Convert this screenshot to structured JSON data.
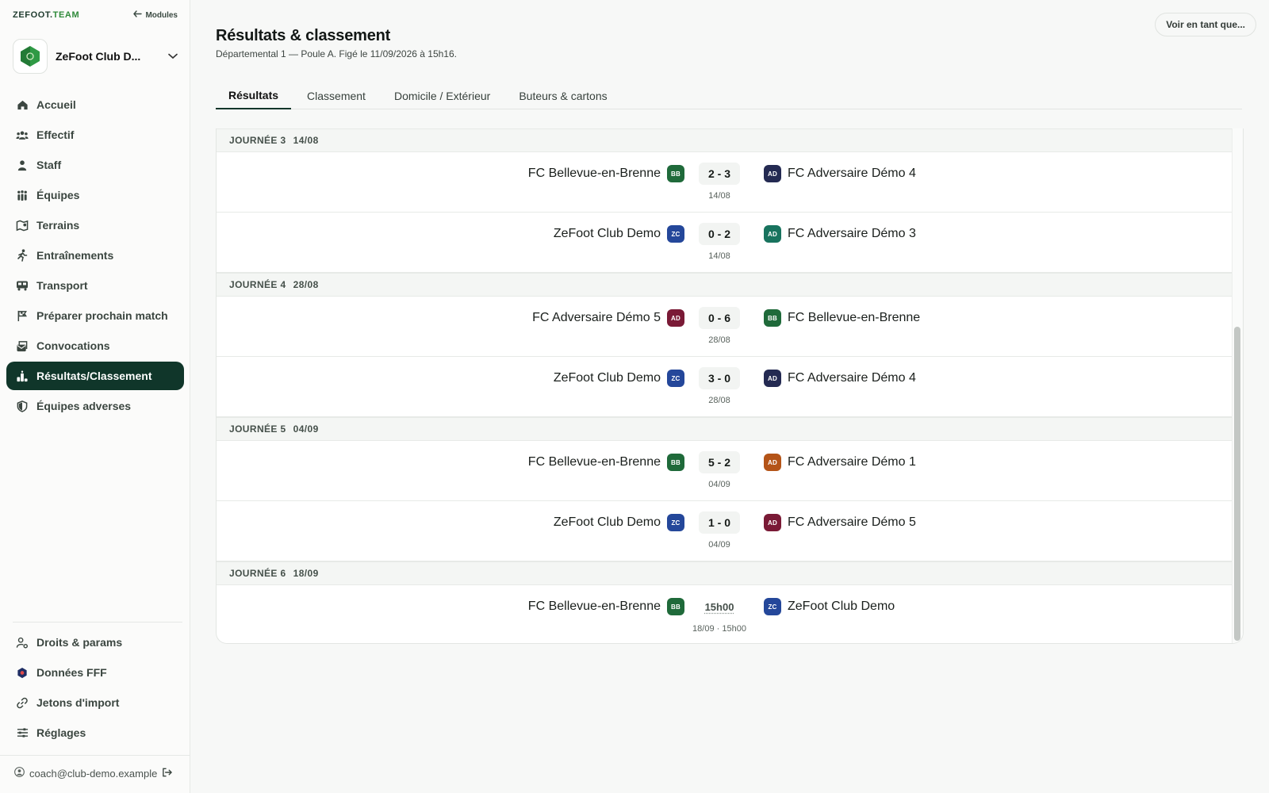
{
  "app": {
    "brand_main": "ZEFOOT.",
    "brand_accent": "TEAM",
    "modules_label": "Modules",
    "club_name": "ZeFoot Club D...",
    "user_email": "coach@club-demo.example"
  },
  "nav": {
    "items": [
      {
        "label": "Accueil",
        "icon": "home-icon"
      },
      {
        "label": "Effectif",
        "icon": "users-icon"
      },
      {
        "label": "Staff",
        "icon": "person-icon"
      },
      {
        "label": "Équipes",
        "icon": "teams-icon"
      },
      {
        "label": "Terrains",
        "icon": "map-icon"
      },
      {
        "label": "Entraînements",
        "icon": "running-icon"
      },
      {
        "label": "Transport",
        "icon": "bus-icon"
      },
      {
        "label": "Préparer prochain match",
        "icon": "flag-icon"
      },
      {
        "label": "Convocations",
        "icon": "envelope-icon"
      },
      {
        "label": "Résultats/Classement",
        "icon": "podium-icon",
        "active": true
      },
      {
        "label": "Équipes adverses",
        "icon": "shield-icon"
      }
    ],
    "bottom": [
      {
        "label": "Droits & params",
        "icon": "user-gear-icon"
      },
      {
        "label": "Données FFF",
        "icon": "fff-icon"
      },
      {
        "label": "Jetons d'import",
        "icon": "link-icon"
      },
      {
        "label": "Réglages",
        "icon": "sliders-icon"
      }
    ]
  },
  "header": {
    "title": "Résultats & classement",
    "subtitle": "Départemental 1 — Poule A. Figé le 11/09/2026 à 15h16.",
    "view_as": "Voir en tant que..."
  },
  "tabs": [
    {
      "label": "Résultats",
      "active": true
    },
    {
      "label": "Classement"
    },
    {
      "label": "Domicile / Extérieur"
    },
    {
      "label": "Buteurs & cartons"
    }
  ],
  "colors": {
    "BB": "#1f6a3a",
    "ZC": "#24479a",
    "AD_navy": "#242a52",
    "AD_teal": "#18735e",
    "AD_maroon": "#7a1a36",
    "AD_orange": "#b45418",
    "active_nav": "#10362a"
  },
  "journees": [
    {
      "label": "JOURNÉE 3",
      "date": "14/08",
      "matches": [
        {
          "home": "FC Bellevue-en-Brenne",
          "home_badge": "BB",
          "home_color": "#1f6a3a",
          "score": "2 - 3",
          "away": "FC Adversaire Démo 4",
          "away_badge": "AD",
          "away_color": "#242a52",
          "date": "14/08"
        },
        {
          "home": "ZeFoot Club Demo",
          "home_badge": "ZC",
          "home_color": "#24479a",
          "score": "0 - 2",
          "away": "FC Adversaire Démo 3",
          "away_badge": "AD",
          "away_color": "#18735e",
          "date": "14/08"
        }
      ]
    },
    {
      "label": "JOURNÉE 4",
      "date": "28/08",
      "matches": [
        {
          "home": "FC Adversaire Démo 5",
          "home_badge": "AD",
          "home_color": "#7a1a36",
          "score": "0 - 6",
          "away": "FC Bellevue-en-Brenne",
          "away_badge": "BB",
          "away_color": "#1f6a3a",
          "date": "28/08"
        },
        {
          "home": "ZeFoot Club Demo",
          "home_badge": "ZC",
          "home_color": "#24479a",
          "score": "3 - 0",
          "away": "FC Adversaire Démo 4",
          "away_badge": "AD",
          "away_color": "#242a52",
          "date": "28/08"
        }
      ]
    },
    {
      "label": "JOURNÉE 5",
      "date": "04/09",
      "matches": [
        {
          "home": "FC Bellevue-en-Brenne",
          "home_badge": "BB",
          "home_color": "#1f6a3a",
          "score": "5 - 2",
          "away": "FC Adversaire Démo 1",
          "away_badge": "AD",
          "away_color": "#b45418",
          "date": "04/09"
        },
        {
          "home": "ZeFoot Club Demo",
          "home_badge": "ZC",
          "home_color": "#24479a",
          "score": "1 - 0",
          "away": "FC Adversaire Démo 5",
          "away_badge": "AD",
          "away_color": "#7a1a36",
          "date": "04/09"
        }
      ]
    },
    {
      "label": "JOURNÉE 6",
      "date": "18/09",
      "matches": [
        {
          "home": "FC Bellevue-en-Brenne",
          "home_badge": "BB",
          "home_color": "#1f6a3a",
          "score": "15h00",
          "pending": true,
          "away": "ZeFoot Club Demo",
          "away_badge": "ZC",
          "away_color": "#24479a",
          "date": "18/09 · 15h00"
        }
      ]
    }
  ]
}
